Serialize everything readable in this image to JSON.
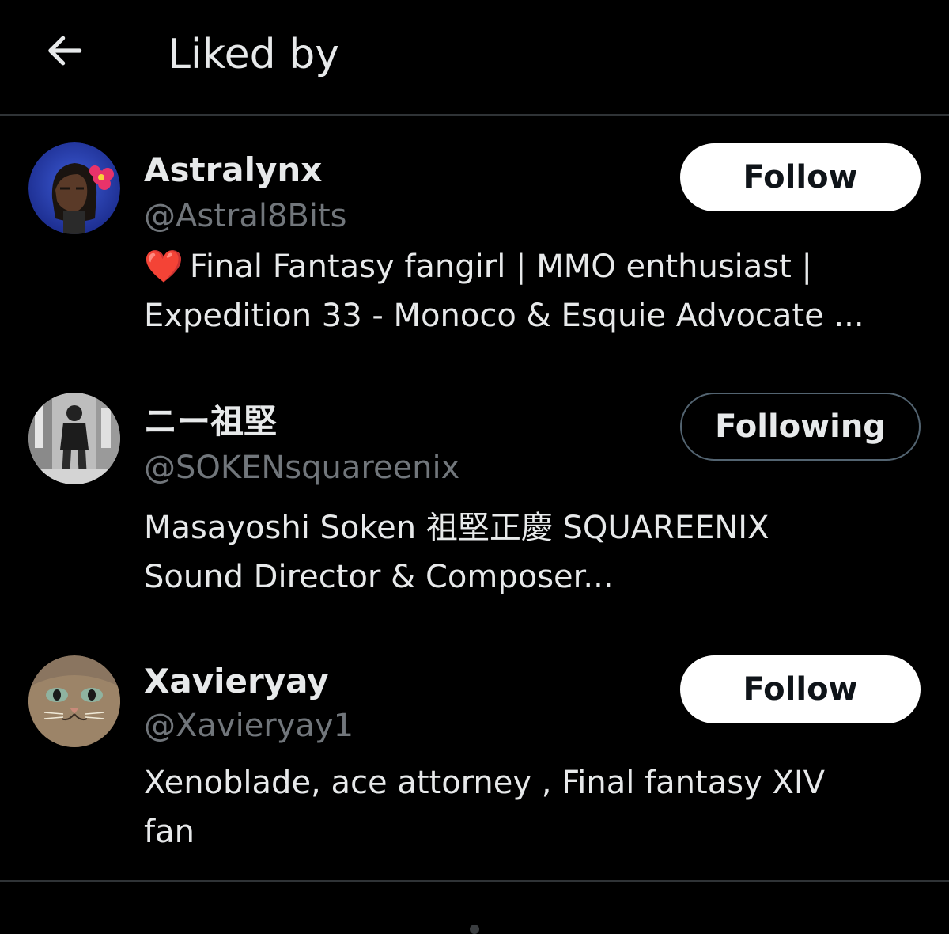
{
  "header": {
    "title": "Liked by",
    "back_icon": "arrow-left-icon"
  },
  "colors": {
    "background": "#000000",
    "divider": "#2f3336",
    "text_primary": "#e7e9ea",
    "text_secondary": "#71767b",
    "heart": "#f4212e"
  },
  "users": [
    {
      "name": "Astralynx",
      "handle": "@Astral8Bits",
      "bio_emoji": "❤️",
      "bio_lines": [
        "Final Fantasy fangirl | MMO enthusiast |",
        "Expedition 33 - Monoco & Esquie Advocate ..."
      ],
      "button_label": "Follow",
      "button_state": "not-following"
    },
    {
      "name": "ニー祖堅",
      "handle": "@SOKENsquareenix",
      "bio_lines": [
        "Masayoshi Soken 祖堅正慶 SQUAREENIX",
        "Sound Director & Composer..."
      ],
      "button_label": "Following",
      "button_state": "following"
    },
    {
      "name": "Xavieryay",
      "handle": "@Xavieryay1",
      "bio_lines": [
        "Xenoblade, ace attorney , Final fantasy XIV",
        "fan"
      ],
      "button_label": "Follow",
      "button_state": "not-following"
    }
  ]
}
